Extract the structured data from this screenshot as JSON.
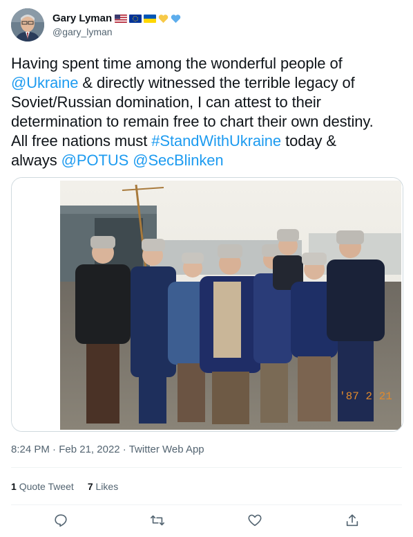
{
  "author": {
    "display_name": "Gary Lyman",
    "handle": "@gary_lyman",
    "name_emojis": [
      "us-flag-icon",
      "eu-flag-icon",
      "ukraine-flag-icon",
      "yellow-heart-icon",
      "blue-heart-icon"
    ]
  },
  "tweet": {
    "text_1": "Having spent time among the wonderful people of\n",
    "mention_ukraine": "@Ukraine",
    "text_2": " & directly witnessed the terrible legacy of\nSoviet/Russian domination, I can attest to their\ndetermination to remain free to chart their own destiny.\nAll free nations must ",
    "hashtag": "#StandWithUkraine",
    "text_3": " today &\nalways ",
    "mention_potus": "@POTUS",
    "text_4": " ",
    "mention_blinken": "@SecBlinken"
  },
  "media": {
    "date_stamp": "'87 2 21"
  },
  "meta": {
    "time": "8:24 PM",
    "sep1": " · ",
    "date": "Feb 21, 2022",
    "sep2": " · ",
    "source": "Twitter Web App"
  },
  "stats": {
    "quote_count": "1",
    "quote_label": "Quote Tweet",
    "like_count": "7",
    "like_label": "Likes"
  },
  "colors": {
    "link": "#1d9bf0",
    "secondary_text": "#536471",
    "divider": "#eff3f4"
  }
}
